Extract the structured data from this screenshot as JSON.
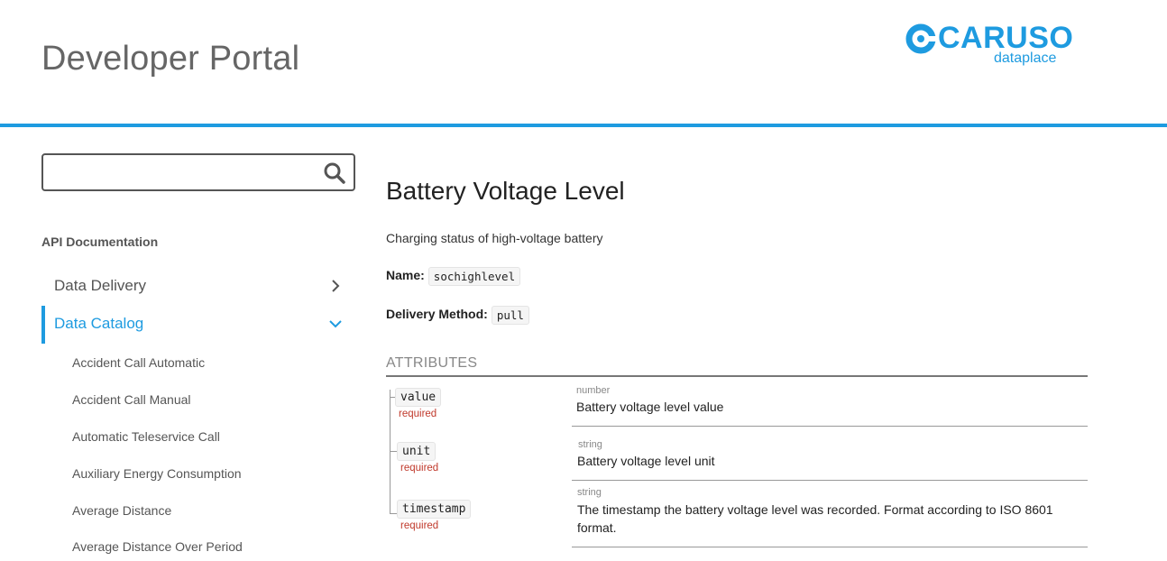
{
  "header": {
    "portal_title": "Developer Portal",
    "logo_word": "CARUSO",
    "logo_sub": "dataplace",
    "accent_color": "#1e9be0"
  },
  "search": {
    "value": "",
    "placeholder": "",
    "icon": "search-icon"
  },
  "sidebar": {
    "heading": "API Documentation",
    "items": [
      {
        "label": "Data Delivery",
        "icon": "chevron-right-icon",
        "expanded": false
      },
      {
        "label": "Data Catalog",
        "icon": "chevron-down-icon",
        "expanded": true
      }
    ],
    "catalog_items": [
      "Accident Call Automatic",
      "Accident Call Manual",
      "Automatic Teleservice Call",
      "Auxiliary Energy Consumption",
      "Average Distance",
      "Average Distance Over Period"
    ]
  },
  "main": {
    "title": "Battery Voltage Level",
    "description": "Charging status of high-voltage battery",
    "name_label": "Name:",
    "name_value": "sochighlevel",
    "delivery_label": "Delivery Method:",
    "delivery_value": "pull",
    "attributes_heading": "ATTRIBUTES",
    "attributes": [
      {
        "name": "value",
        "required": "required",
        "type": "number",
        "description": "Battery voltage level value"
      },
      {
        "name": "unit",
        "required": "required",
        "type": "string",
        "description": "Battery voltage level unit"
      },
      {
        "name": "timestamp",
        "required": "required",
        "type": "string",
        "description": "The timestamp the battery voltage level was recorded. Format according to ISO 8601 format."
      }
    ]
  }
}
